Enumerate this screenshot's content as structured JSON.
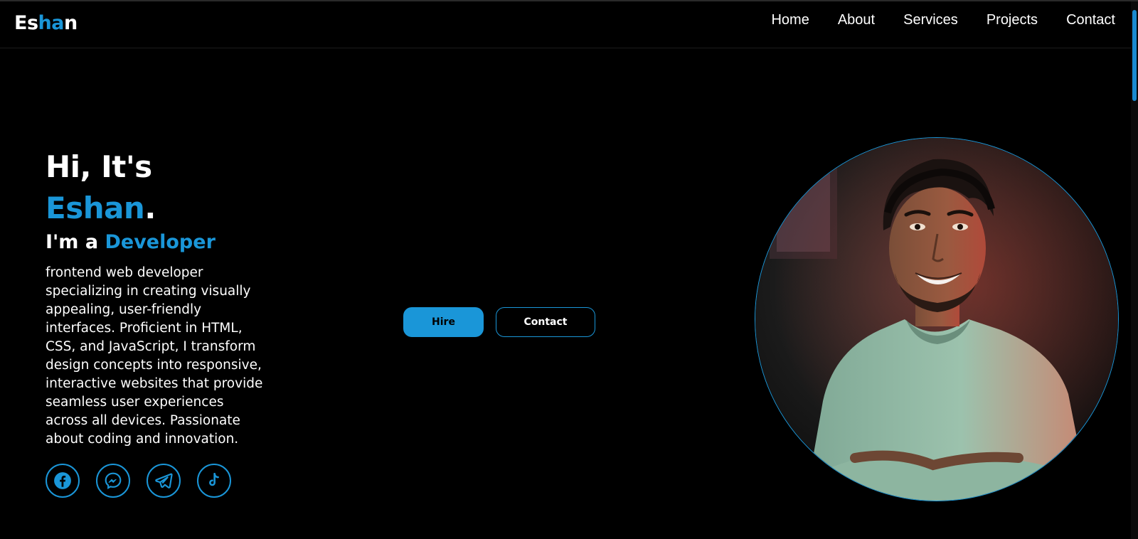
{
  "header": {
    "logo": {
      "part1": "Es",
      "part2": "ha",
      "part3": "n"
    },
    "nav": [
      "Home",
      "About",
      "Services",
      "Projects",
      "Contact"
    ]
  },
  "hero": {
    "greeting": "Hi, It's",
    "name": "Eshan",
    "name_suffix": ".",
    "role_prefix": "I'm a",
    "role": "Developer",
    "bio": "frontend web developer specializing in creating visually appealing, user-friendly interfaces. Proficient in HTML, CSS, and JavaScript, I transform design concepts into responsive, interactive websites that provide seamless user experiences across all devices. Passionate about coding and innovation."
  },
  "buttons": {
    "hire": "Hire",
    "contact": "Contact"
  },
  "socials": [
    "facebook-icon",
    "messenger-icon",
    "telegram-icon",
    "tiktok-icon"
  ],
  "colors": {
    "accent": "#1a96d8",
    "background": "#000000",
    "text": "#ffffff"
  }
}
